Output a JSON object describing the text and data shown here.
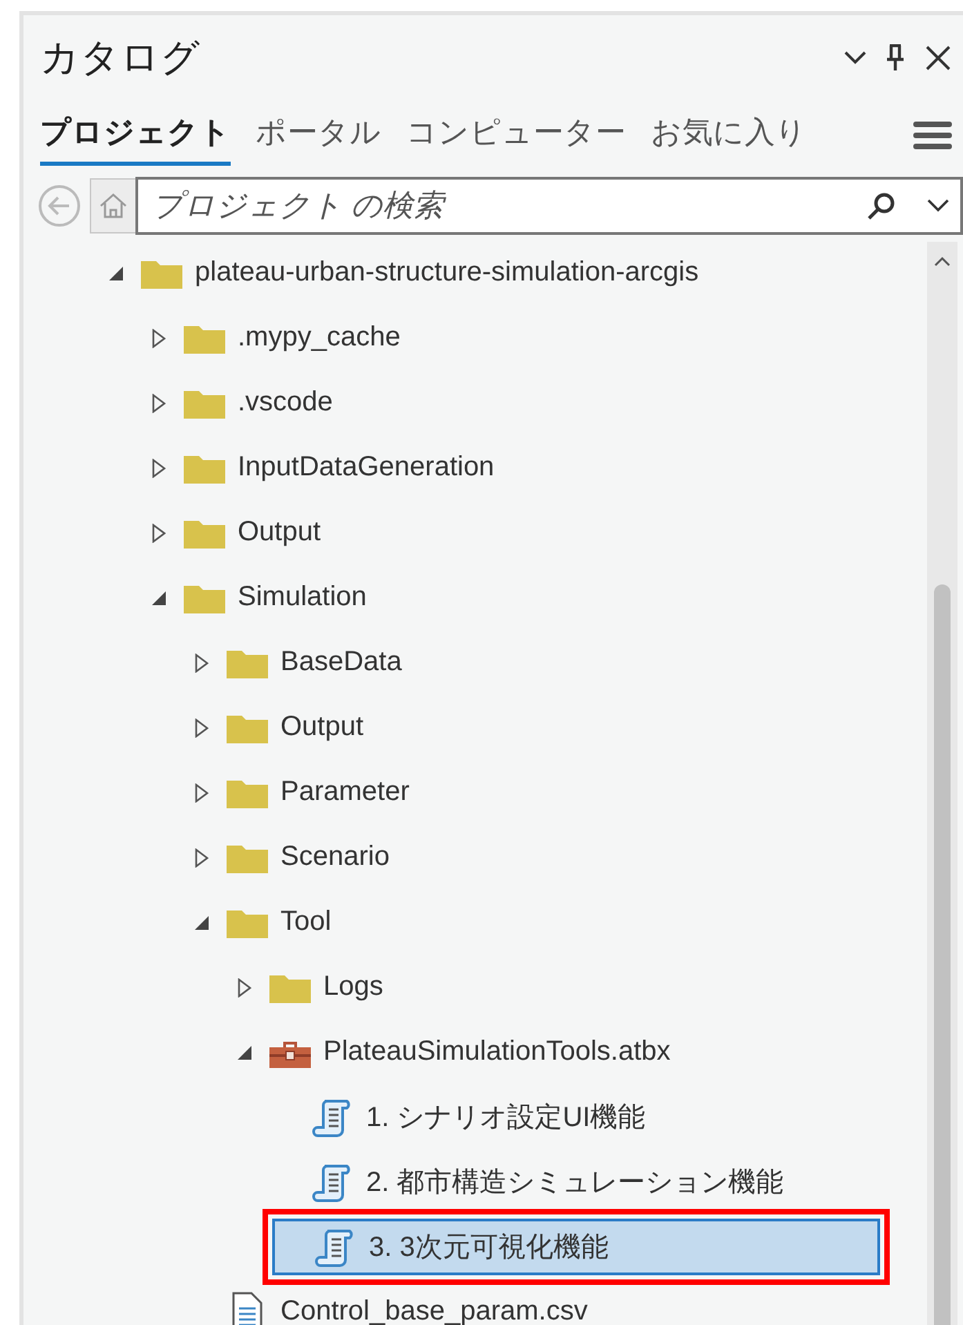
{
  "panel": {
    "title": "カタログ"
  },
  "tabs": [
    {
      "label": "プロジェクト",
      "selected": true
    },
    {
      "label": "ポータル",
      "selected": false
    },
    {
      "label": "コンピューター",
      "selected": false
    },
    {
      "label": "お気に入り",
      "selected": false
    }
  ],
  "search": {
    "placeholder": "プロジェクト の検索"
  },
  "tree": [
    {
      "label": "plateau-urban-structure-simulation-arcgis",
      "kind": "folder",
      "expanded": true,
      "selected": false,
      "children": [
        {
          "label": ".mypy_cache",
          "kind": "folder",
          "expanded": false,
          "selected": false
        },
        {
          "label": ".vscode",
          "kind": "folder",
          "expanded": false,
          "selected": false
        },
        {
          "label": "InputDataGeneration",
          "kind": "folder",
          "expanded": false,
          "selected": false
        },
        {
          "label": "Output",
          "kind": "folder",
          "expanded": false,
          "selected": false
        },
        {
          "label": "Simulation",
          "kind": "folder",
          "expanded": true,
          "selected": false,
          "children": [
            {
              "label": "BaseData",
              "kind": "folder",
              "expanded": false,
              "selected": false
            },
            {
              "label": "Output",
              "kind": "folder",
              "expanded": false,
              "selected": false
            },
            {
              "label": "Parameter",
              "kind": "folder",
              "expanded": false,
              "selected": false
            },
            {
              "label": "Scenario",
              "kind": "folder",
              "expanded": false,
              "selected": false
            },
            {
              "label": "Tool",
              "kind": "folder",
              "expanded": true,
              "selected": false,
              "children": [
                {
                  "label": "Logs",
                  "kind": "folder",
                  "expanded": false,
                  "selected": false
                },
                {
                  "label": "PlateauSimulationTools.atbx",
                  "kind": "toolbox",
                  "expanded": true,
                  "selected": false,
                  "children": [
                    {
                      "label": "1. シナリオ設定UI機能",
                      "kind": "script",
                      "selected": false
                    },
                    {
                      "label": "2. 都市構造シミュレーション機能",
                      "kind": "script",
                      "selected": false
                    },
                    {
                      "label": "3. 3次元可視化機能",
                      "kind": "script",
                      "selected": true,
                      "annotated": true
                    }
                  ]
                }
              ]
            },
            {
              "label": "Control_base_param.csv",
              "kind": "file",
              "selected": false
            }
          ]
        }
      ]
    }
  ]
}
